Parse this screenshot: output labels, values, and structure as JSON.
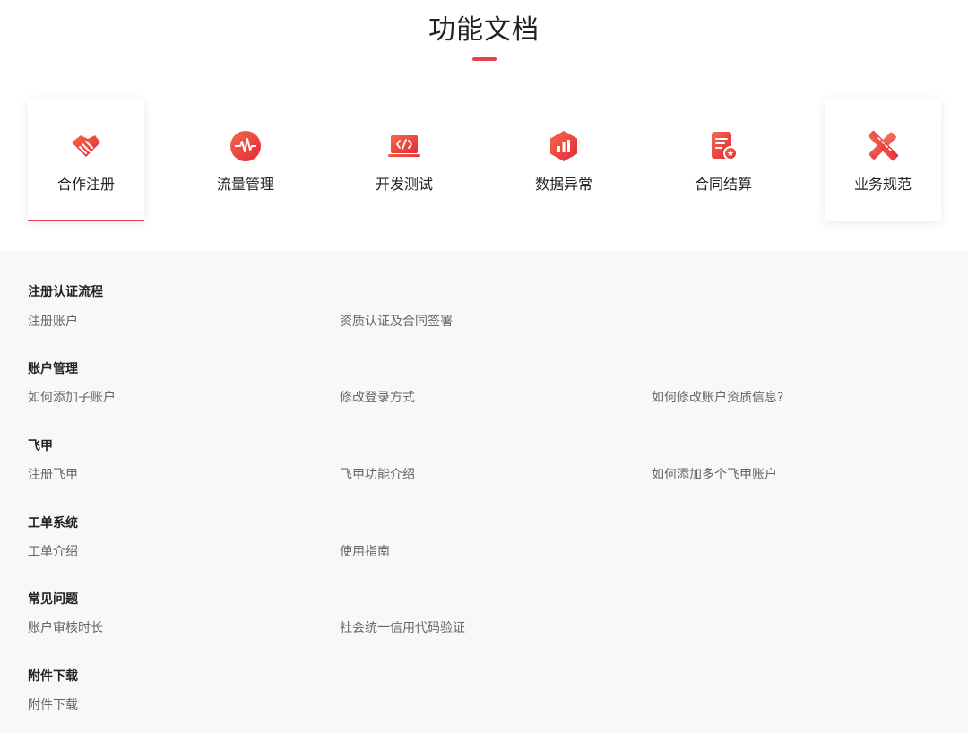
{
  "title": "功能文档",
  "colors": {
    "accent": "#e8414a",
    "background_bottom": "#f8f8f8"
  },
  "tabs": [
    {
      "label": "合作注册",
      "icon": "handshake-icon",
      "active": true
    },
    {
      "label": "流量管理",
      "icon": "pulse-icon",
      "active": false
    },
    {
      "label": "开发测试",
      "icon": "code-laptop-icon",
      "active": false
    },
    {
      "label": "数据异常",
      "icon": "bar-chart-hexagon-icon",
      "active": false
    },
    {
      "label": "合同结算",
      "icon": "contract-icon",
      "active": false
    },
    {
      "label": "业务规范",
      "icon": "pencil-ruler-icon",
      "active": false
    }
  ],
  "sections": [
    {
      "title": "注册认证流程",
      "links": [
        "注册账户",
        "资质认证及合同签署"
      ]
    },
    {
      "title": "账户管理",
      "links": [
        "如何添加子账户",
        "修改登录方式",
        "如何修改账户资质信息?"
      ]
    },
    {
      "title": "飞甲",
      "links": [
        "注册飞甲",
        "飞甲功能介绍",
        "如何添加多个飞甲账户"
      ]
    },
    {
      "title": "工单系统",
      "links": [
        "工单介绍",
        "使用指南"
      ]
    },
    {
      "title": "常见问题",
      "links": [
        "账户审核时长",
        "社会统一信用代码验证"
      ]
    },
    {
      "title": "附件下载",
      "links": [
        "附件下载"
      ]
    }
  ]
}
